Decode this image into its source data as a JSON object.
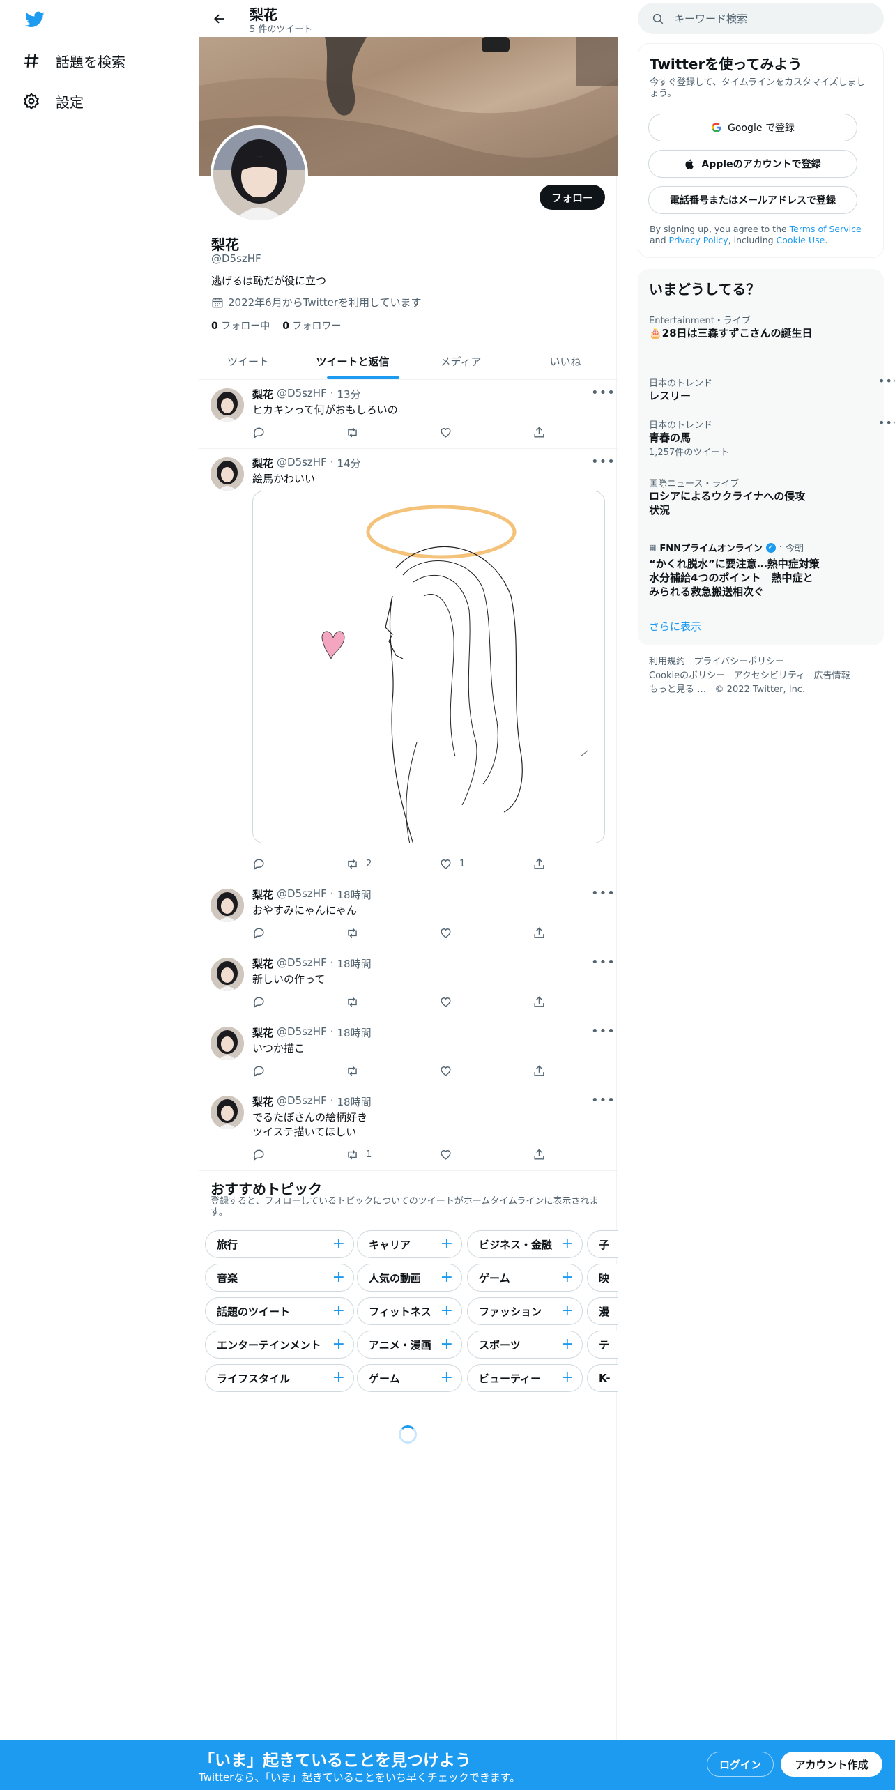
{
  "nav": {
    "items": [
      {
        "label": "話題を検索",
        "icon": "hashtag-icon"
      },
      {
        "label": "設定",
        "icon": "gear-icon"
      }
    ]
  },
  "header": {
    "title": "梨花",
    "subtitle": "5 件のツイート"
  },
  "profile": {
    "name": "梨花",
    "handle": "@D5szHF",
    "bio": "逃げるは恥だが役に立つ",
    "joined": "2022年6月からTwitterを利用しています",
    "following_count": "0",
    "following_label": "フォロー中",
    "followers_count": "0",
    "followers_label": "フォロワー",
    "follow_button": "フォロー"
  },
  "tabs": [
    {
      "label": "ツイート",
      "active": false
    },
    {
      "label": "ツイートと返信",
      "active": true
    },
    {
      "label": "メディア",
      "active": false
    },
    {
      "label": "いいね",
      "active": false
    }
  ],
  "tweets": [
    {
      "name": "梨花",
      "handle": "@D5szHF",
      "sep": "·",
      "time": "13分",
      "text": "ヒカキンって何がおもしろいの",
      "retweets": "",
      "likes": ""
    },
    {
      "name": "梨花",
      "handle": "@D5szHF",
      "sep": "·",
      "time": "14分",
      "text": "絵馬かわいい",
      "retweets": "2",
      "likes": "1"
    },
    {
      "name": "梨花",
      "handle": "@D5szHF",
      "sep": "·",
      "time": "18時間",
      "text": "おやすみにゃんにゃん",
      "retweets": "",
      "likes": ""
    },
    {
      "name": "梨花",
      "handle": "@D5szHF",
      "sep": "·",
      "time": "18時間",
      "text": "新しいの作って",
      "retweets": "",
      "likes": ""
    },
    {
      "name": "梨花",
      "handle": "@D5szHF",
      "sep": "·",
      "time": "18時間",
      "text": "いつか描こ",
      "retweets": "",
      "likes": ""
    },
    {
      "name": "梨花",
      "handle": "@D5szHF",
      "sep": "·",
      "time": "18時間",
      "text_line1": "でるたぽさんの絵柄好き",
      "text_line2": "ツイステ描いてほしい",
      "retweets": "1",
      "likes": ""
    }
  ],
  "topics": {
    "title": "おすすめトピック",
    "subtitle": "登録すると、フォローしているトピックについてのツイートがホームタイムラインに表示されます。",
    "rows": [
      [
        "旅行",
        "キャリア",
        "ビジネス・金融",
        "子"
      ],
      [
        "音楽",
        "人気の動画",
        "ゲーム",
        "映"
      ],
      [
        "話題のツイート",
        "フィットネス",
        "ファッション",
        "漫"
      ],
      [
        "エンターテインメント",
        "アニメ・漫画",
        "スポーツ",
        "テ"
      ],
      [
        "ライフスタイル",
        "ゲーム",
        "ビューティー",
        "K-"
      ]
    ]
  },
  "search": {
    "placeholder": "キーワード検索"
  },
  "signup_card": {
    "title": "Twitterを使ってみよう",
    "desc": "今すぐ登録して、タイムラインをカスタマイズしましょう。",
    "google": "Google で登録",
    "apple": "Appleのアカウントで登録",
    "phone": "電話番号またはメールアドレスで登録",
    "terms_prefix": "By signing up, you agree to the ",
    "terms_link": "Terms of Service",
    "terms_and": " and ",
    "privacy_link": "Privacy Policy",
    "terms_mid": ", including ",
    "cookie_link": "Cookie Use",
    "terms_end": "."
  },
  "trends_card": {
    "title": "いまどうしてる？",
    "items": [
      {
        "category": "Entertainment・ライブ",
        "title": "🎂28日は三森すずこさんの誕生日"
      },
      {
        "category": "日本のトレンド",
        "title": "レスリー"
      },
      {
        "category": "日本のトレンド",
        "title": "青春の馬",
        "count": "1,257件のツイート"
      },
      {
        "category": "国際ニュース・ライブ",
        "title": "ロシアによるウクライナへの侵攻状況"
      }
    ],
    "news": {
      "source": "FNNプライムオンライン",
      "time": "今朝",
      "title": "“かくれ脱水”に要注意…熱中症対策 水分補給4つのポイント　熱中症と みられる救急搬送相次ぐ"
    },
    "show_more": "さらに表示"
  },
  "footer": {
    "terms": "利用規約",
    "privacy": "プライバシーポリシー",
    "cookie": "Cookieのポリシー",
    "accessibility": "アクセシビリティ",
    "ads": "広告情報",
    "more": "もっと見る …",
    "copyright": "© 2022 Twitter, Inc."
  },
  "bottom_bar": {
    "title": "「いま」起きていることを見つけよう",
    "subtitle": "Twitterなら、「いま」起きていることをいち早くチェックできます。",
    "login": "ログイン",
    "signup": "アカウント作成"
  },
  "colors": {
    "accent": "#1d9bf0",
    "text": "#0f1419",
    "muted": "#536471"
  }
}
